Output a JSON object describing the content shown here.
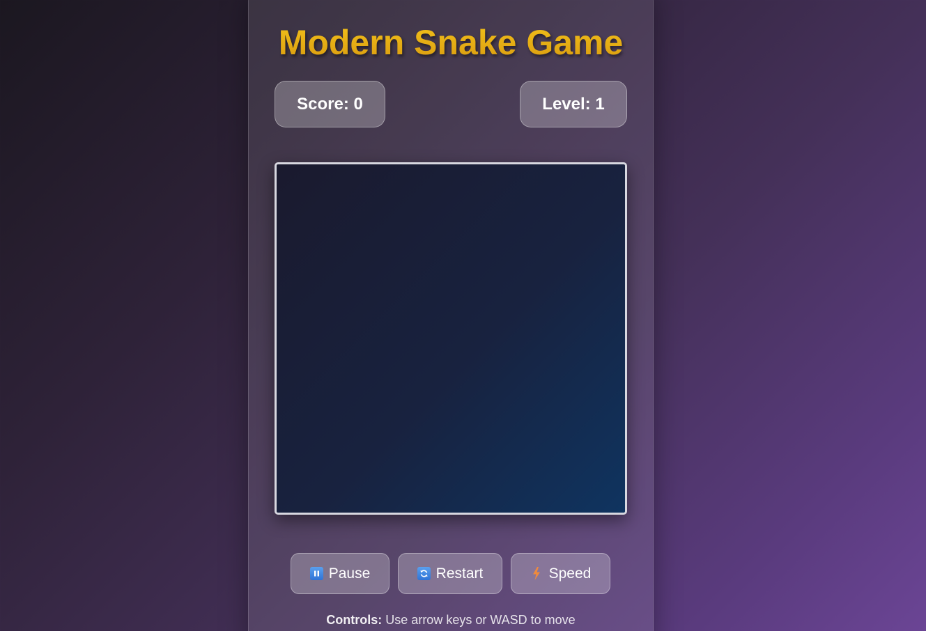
{
  "title": "Modern Snake Game",
  "stats": {
    "score_label": "Score: 0",
    "level_label": "Level: 1"
  },
  "buttons": {
    "pause": {
      "label": "Pause",
      "icon": "pause-icon"
    },
    "restart": {
      "label": "Restart",
      "icon": "restart-icon"
    },
    "speed": {
      "label": "Speed",
      "icon": "lightning-icon"
    }
  },
  "controls": {
    "heading": "Controls:",
    "text": "Use arrow keys or WASD to move"
  },
  "colors": {
    "title": "#e0ab12",
    "board_start": "#1a1a2e",
    "board_end": "#0f3460",
    "accent_icon": "#2f73d6"
  }
}
